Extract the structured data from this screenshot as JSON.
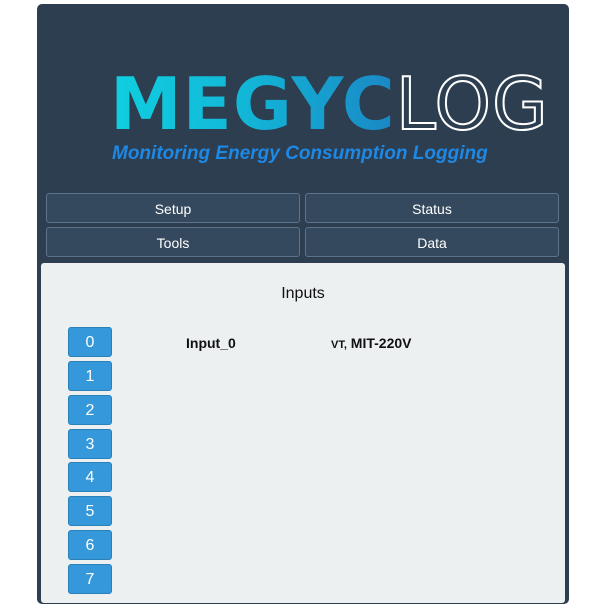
{
  "logo": {
    "word_strong": "MEGYC",
    "word_thin": "LOG",
    "tagline": "Monitoring Energy Consumption Logging"
  },
  "nav": {
    "setup": "Setup",
    "status": "Status",
    "tools": "Tools",
    "data": "Data"
  },
  "panel": {
    "title": "Inputs",
    "inputs": [
      {
        "index": "0",
        "name": "Input_0",
        "type_prefix": "VT,",
        "type": "MIT-220V"
      },
      {
        "index": "1"
      },
      {
        "index": "2"
      },
      {
        "index": "3"
      },
      {
        "index": "4"
      },
      {
        "index": "5"
      },
      {
        "index": "6"
      },
      {
        "index": "7"
      }
    ]
  }
}
